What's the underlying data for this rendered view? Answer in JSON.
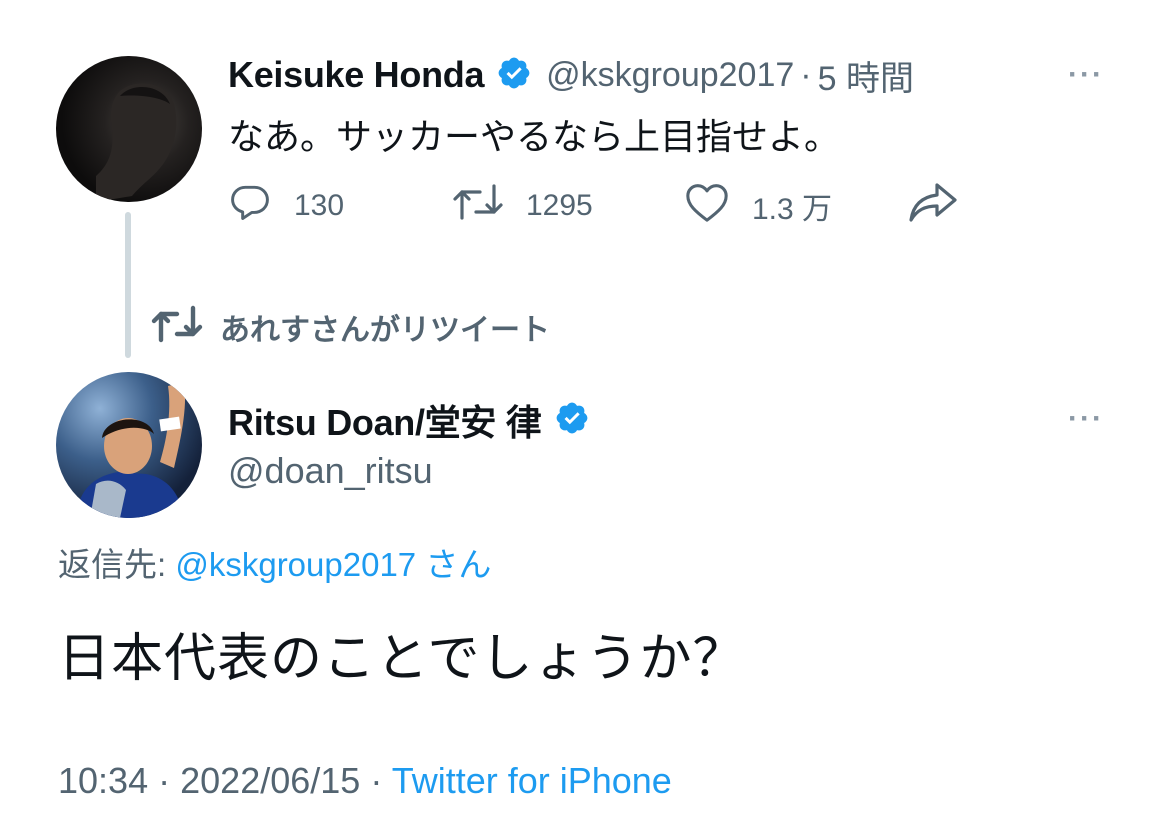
{
  "tweet1": {
    "name": "Keisuke Honda",
    "handle": "@kskgroup2017",
    "sep": "·",
    "time": "5 時間",
    "text": "なあ。サッカーやるなら上目指せよ。",
    "replies": "130",
    "retweets": "1295",
    "likes": "1.3 万",
    "more": "···"
  },
  "retweet_banner": "あれすさんがリツイート",
  "tweet2": {
    "name": "Ritsu Doan/堂安 律",
    "handle": "@doan_ritsu",
    "more": "···",
    "reply_to_prefix": "返信先: ",
    "reply_to_handle": "@kskgroup2017 さん",
    "text": "日本代表のことでしょうか？",
    "time": "10:34",
    "sep1": "·",
    "date": "2022/06/15",
    "sep2": "·",
    "source": "Twitter for iPhone"
  },
  "colors": {
    "accent": "#1d9bf0",
    "text": "#0f1419",
    "muted": "#536471",
    "line": "#cfd9de"
  }
}
